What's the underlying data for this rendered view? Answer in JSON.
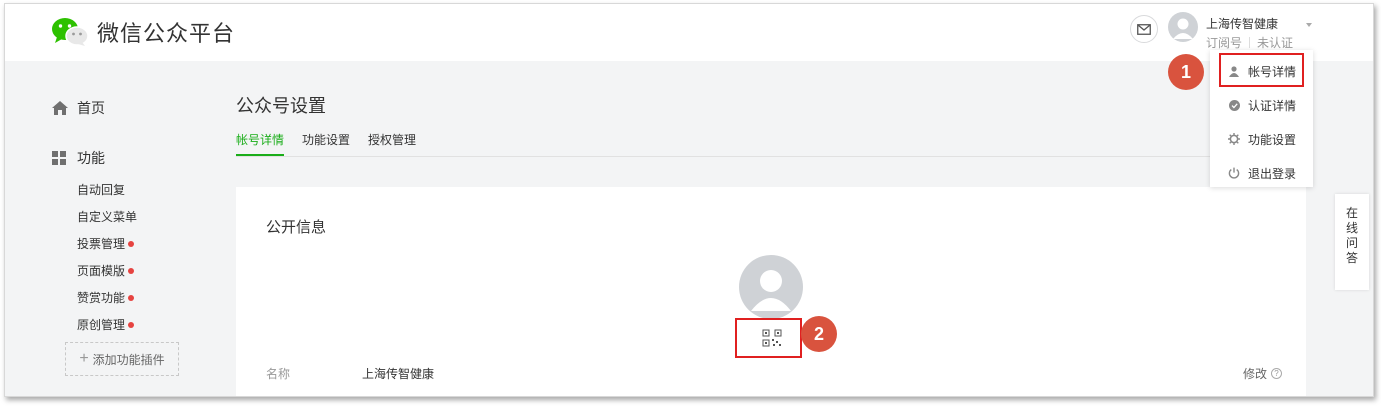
{
  "app": {
    "title": "微信公众平台",
    "brand_color": "#1aad19"
  },
  "header": {
    "mail_icon": "mail-icon",
    "account_name": "上海传智健康",
    "account_type": "订阅号",
    "verify_status": "未认证"
  },
  "dropdown": {
    "items": [
      {
        "label": "帐号详情",
        "icon": "user-icon"
      },
      {
        "label": "认证详情",
        "icon": "check-circle-icon"
      },
      {
        "label": "功能设置",
        "icon": "gear-icon"
      },
      {
        "label": "退出登录",
        "icon": "power-icon"
      }
    ]
  },
  "sidebar": {
    "home": "首页",
    "functions": "功能",
    "items": [
      {
        "label": "自动回复",
        "new": false
      },
      {
        "label": "自定义菜单",
        "new": false
      },
      {
        "label": "投票管理",
        "new": true
      },
      {
        "label": "页面模版",
        "new": true
      },
      {
        "label": "赞赏功能",
        "new": true
      },
      {
        "label": "原创管理",
        "new": true
      }
    ],
    "add_plugin": "添加功能插件"
  },
  "main": {
    "page_title": "公众号设置",
    "tabs": [
      "帐号详情",
      "功能设置",
      "授权管理"
    ],
    "section_title": "公开信息",
    "name_label": "名称",
    "name_value": "上海传智健康",
    "edit_label": "修改"
  },
  "annotations": {
    "badge1": "1",
    "badge2": "2",
    "color": "#e02020"
  },
  "online_help": [
    "在",
    "线",
    "问",
    "答"
  ]
}
